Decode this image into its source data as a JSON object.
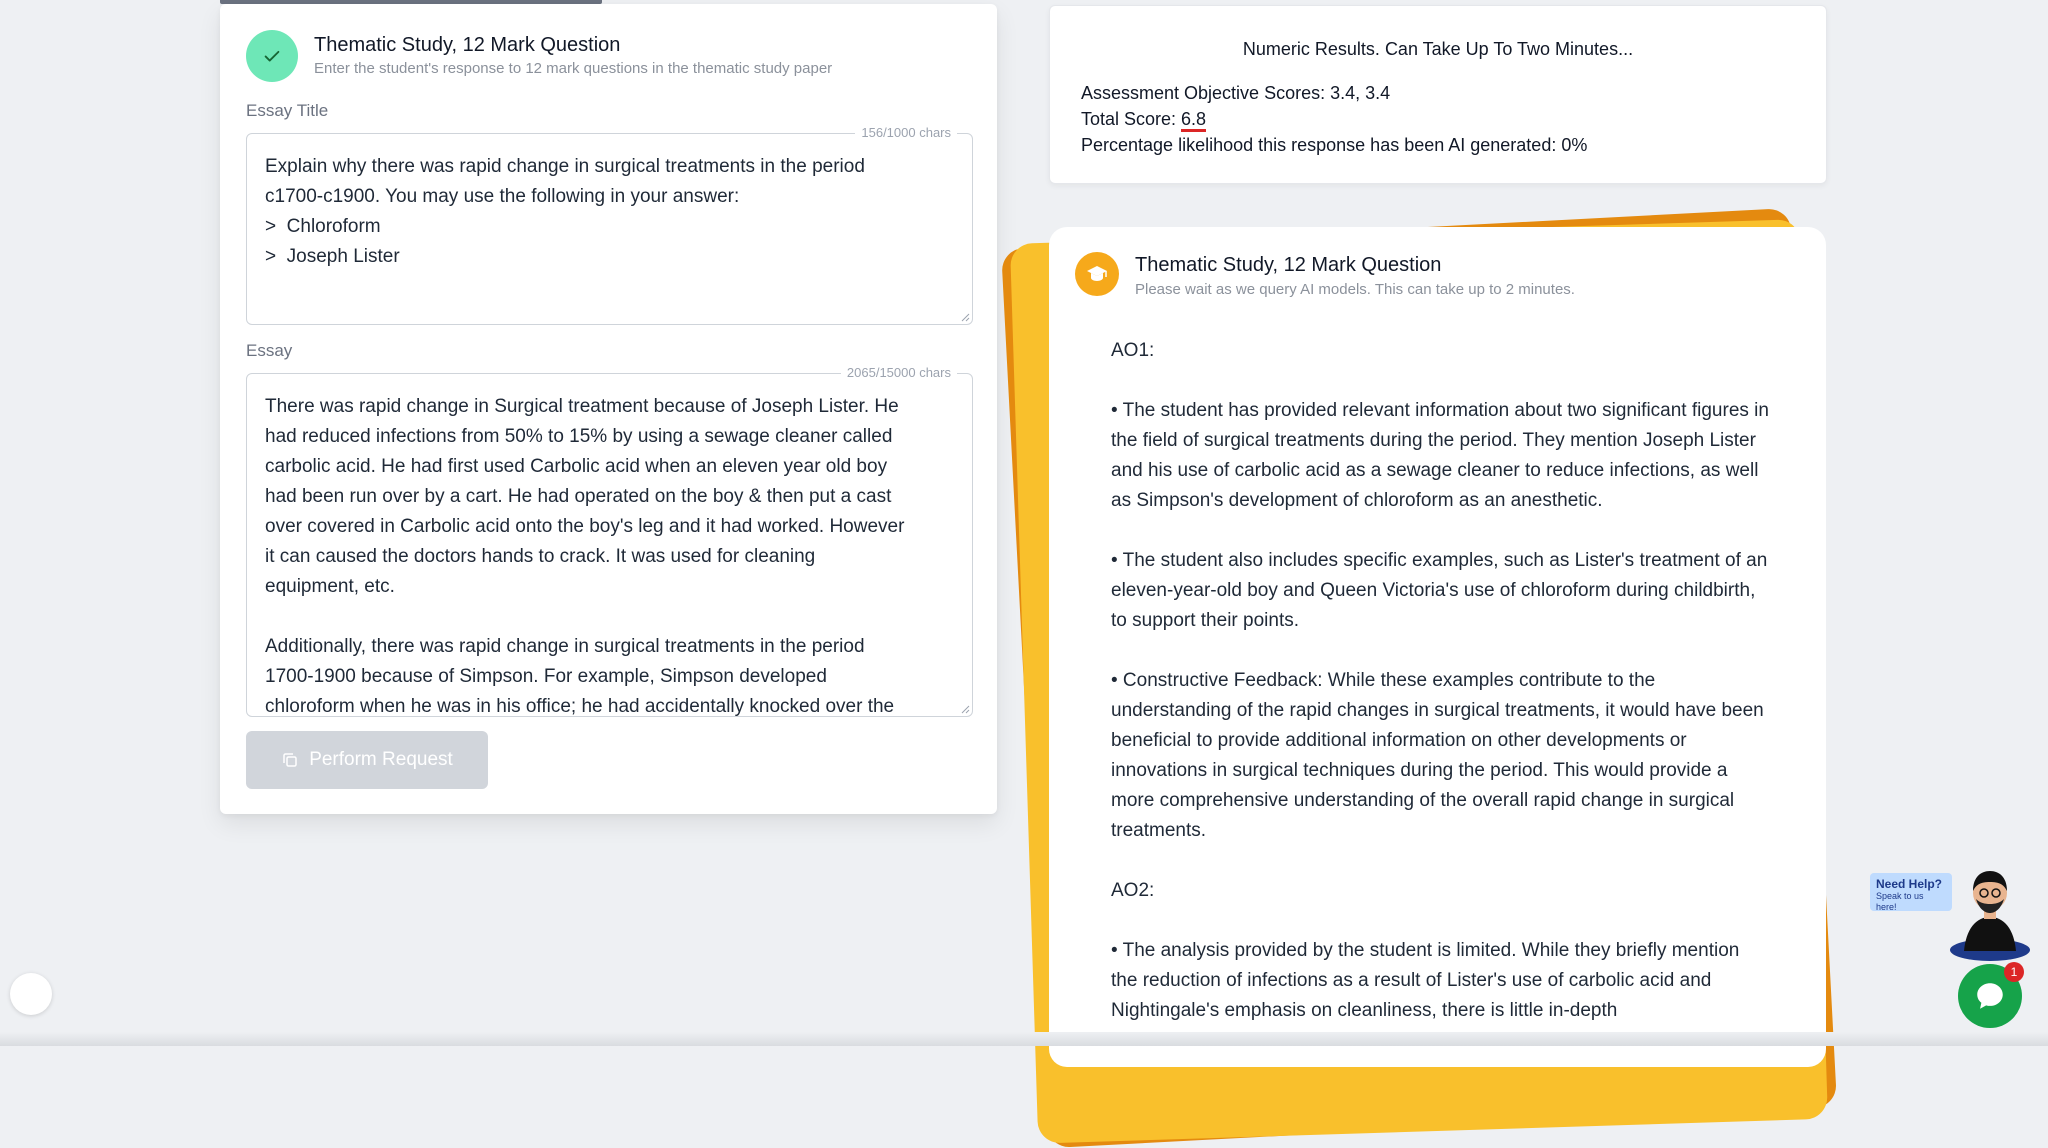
{
  "form": {
    "title": "Thematic Study, 12 Mark Question",
    "subtitle": "Enter the student's response to 12 mark questions in the thematic study paper",
    "essay_title_label": "Essay Title",
    "essay_title_count": "156/1000 chars",
    "essay_title_value": "Explain why there was rapid change in surgical treatments in the period\nc1700-c1900. You may use the following in your answer:\n>  Chloroform\n>  Joseph Lister",
    "essay_label": "Essay",
    "essay_count": "2065/15000 chars",
    "essay_value": "There was rapid change in Surgical treatment because of Joseph Lister. He\nhad reduced infections from 50% to 15% by using a sewage cleaner called\ncarbolic acid. He had first used Carbolic acid when an eleven year old boy\nhad been run over by a cart. He had operated on the boy & then put a cast\nover covered in Carbolic acid onto the boy's leg and it had worked. However\nit can caused the doctors hands to crack. It was used for cleaning\nequipment, etc.\n\nAdditionally, there was rapid change in surgical treatments in the period\n1700-1900 because of Simpson. For example, Simpson developed\nchloroform when he was in his office; he had accidentally knocked over the",
    "perform_label": "Perform Request"
  },
  "numeric": {
    "title": "Numeric Results. Can Take Up To Two Minutes...",
    "ao_scores": "Assessment Objective Scores: 3.4, 3.4",
    "total_prefix": "Total Score: ",
    "total_value": "6.8",
    "ai_likelihood": "Percentage likelihood this response has been AI generated: 0%"
  },
  "feedback": {
    "title": "Thematic Study, 12 Mark Question",
    "subtitle": "Please wait as we query AI models. This can take up to 2 minutes.",
    "ao1_heading": "AO1:",
    "ao1_points": [
      "• The student has provided relevant information about two significant figures in the field of surgical treatments during the period. They mention Joseph Lister and his use of carbolic acid as a sewage cleaner to reduce infections, as well as Simpson's development of chloroform as an anesthetic.",
      "• The student also includes specific examples, such as Lister's treatment of an eleven-year-old boy and Queen Victoria's use of chloroform during childbirth, to support their points.",
      "• Constructive Feedback: While these examples contribute to the understanding of the rapid changes in surgical treatments, it would have been beneficial to provide additional information on other developments or innovations in surgical techniques during the period. This would provide a more comprehensive understanding of the overall rapid change in surgical treatments."
    ],
    "ao2_heading": "AO2:",
    "ao2_points": [
      "• The analysis provided by the student is limited. While they briefly mention the reduction of infections as a result of Lister's use of carbolic acid and Nightingale's emphasis on cleanliness, there is little in-depth"
    ]
  },
  "help": {
    "title": "Need Help?",
    "subtitle": "Speak to us here!",
    "badge": "1"
  },
  "colors": {
    "success": "#6ee7b7",
    "accent_orange": "#e48a0f",
    "accent_yellow": "#f9c02c",
    "chat_green": "#16a34a",
    "score_underline": "#dc2626"
  },
  "icons": [
    "check-icon",
    "graduation-cap-icon",
    "copy-icon",
    "chat-icon"
  ]
}
